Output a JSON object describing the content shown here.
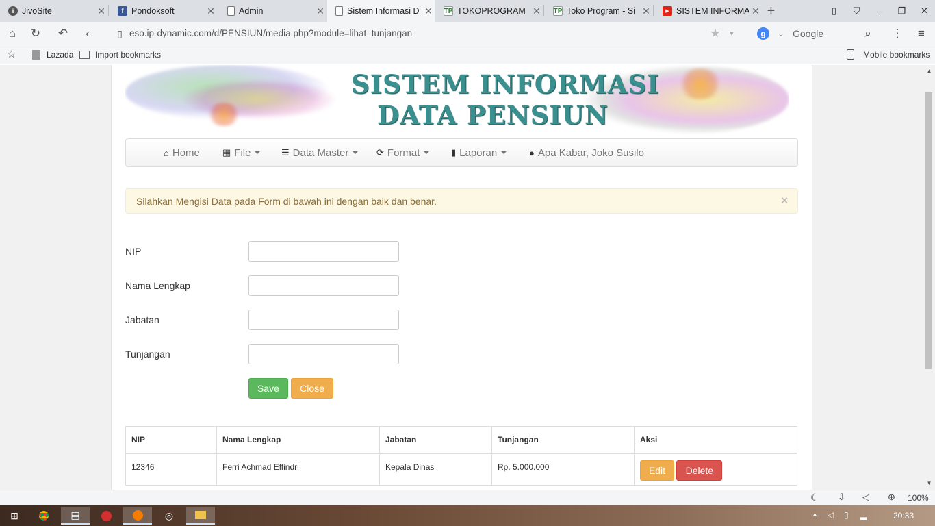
{
  "browser": {
    "tabs": [
      {
        "title": "JivoSite"
      },
      {
        "title": "Pondoksoft"
      },
      {
        "title": "Admin"
      },
      {
        "title": "Sistem Informasi D"
      },
      {
        "title": "TOKOPROGRAM"
      },
      {
        "title": "Toko Program - Si"
      },
      {
        "title": "SISTEM INFORMA"
      }
    ],
    "url": "eso.ip-dynamic.com/d/PENSIUN/media.php?module=lihat_tunjangan",
    "search_engine": "Google",
    "bookmarks": [
      "Lazada",
      "Import bookmarks"
    ],
    "mobile_bookmarks": "Mobile bookmarks",
    "zoom": "100%"
  },
  "banner": {
    "line1": "SISTEM INFORMASI",
    "line2": "DATA PENSIUN"
  },
  "nav": {
    "home": "Home",
    "file": "File",
    "data_master": "Data Master",
    "format": "Format",
    "laporan": "Laporan",
    "greeting": "Apa Kabar, Joko Susilo"
  },
  "alert": {
    "message": "Silahkan Mengisi Data pada Form di bawah ini dengan baik dan benar.",
    "close": "×"
  },
  "form": {
    "nip_label": "NIP",
    "nama_label": "Nama Lengkap",
    "jabatan_label": "Jabatan",
    "tunjangan_label": "Tunjangan",
    "save": "Save",
    "close": "Close"
  },
  "table": {
    "headers": [
      "NIP",
      "Nama Lengkap",
      "Jabatan",
      "Tunjangan",
      "Aksi"
    ],
    "rows": [
      {
        "nip": "12346",
        "nama": "Ferri Achmad Effindri",
        "jabatan": "Kepala Dinas",
        "tunjangan": "Rp. 5.000.000",
        "edit": "Edit",
        "delete": "Delete"
      }
    ]
  },
  "taskbar": {
    "time": "20:33"
  },
  "colors": {
    "save": "#5cb85c",
    "close": "#f0ad4e",
    "delete": "#d9534f",
    "alert_bg": "#fcf8e3",
    "banner_text": "#3a8f8f"
  }
}
